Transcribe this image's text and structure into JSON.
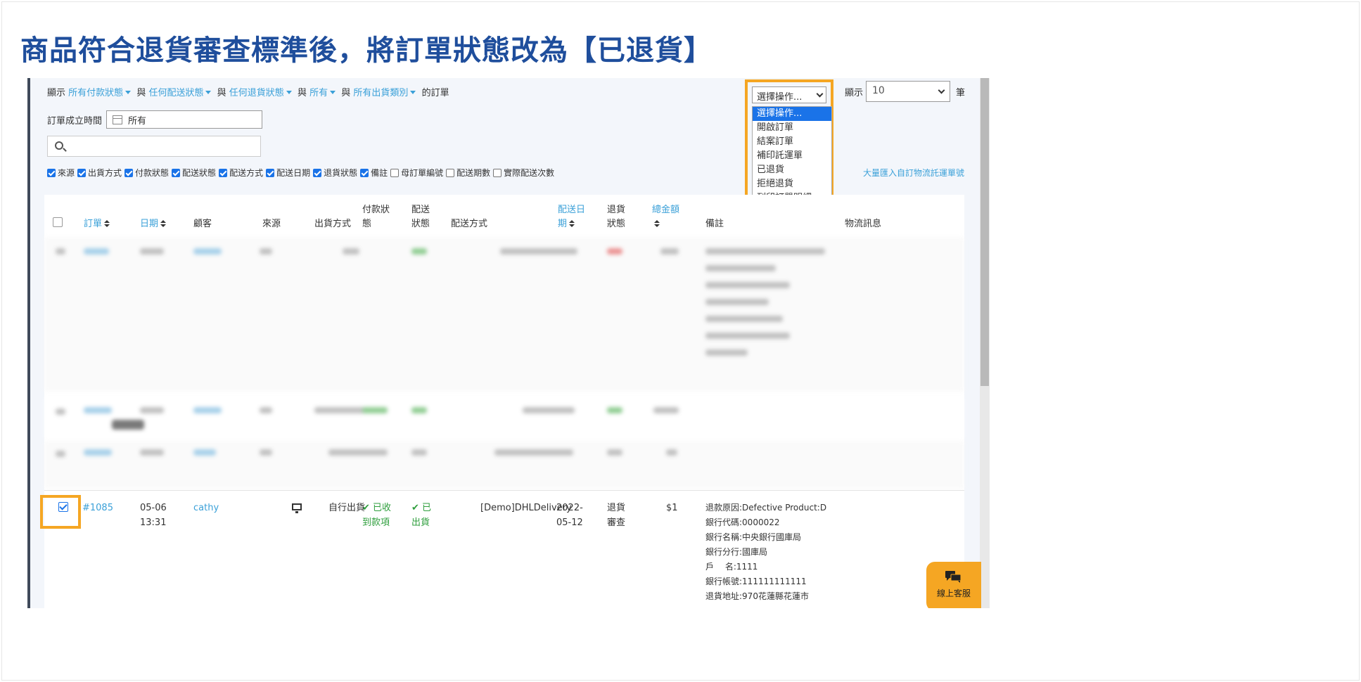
{
  "page_title": "商品符合退貨審查標準後，將訂單狀態改為【已退貨】",
  "filters": {
    "show_label": "顯示",
    "payment_status": "所有付款狀態",
    "and1": "與",
    "delivery_status": "任何配送狀態",
    "and2": "與",
    "return_status": "任何退貨狀態",
    "and3": "與",
    "all": "所有",
    "and4": "與",
    "ship_type": "所有出貨類別",
    "suffix": "的訂單",
    "date_label": "訂單成立時間",
    "date_value": "所有",
    "search_placeholder": ""
  },
  "column_toggles": [
    {
      "label": "來源",
      "checked": true
    },
    {
      "label": "出貨方式",
      "checked": true
    },
    {
      "label": "付款狀態",
      "checked": true
    },
    {
      "label": "配送狀態",
      "checked": true
    },
    {
      "label": "配送方式",
      "checked": true
    },
    {
      "label": "配送日期",
      "checked": true
    },
    {
      "label": "退貨狀態",
      "checked": true
    },
    {
      "label": "備註",
      "checked": true
    },
    {
      "label": "母訂單編號",
      "checked": false
    },
    {
      "label": "配送期數",
      "checked": false
    },
    {
      "label": "實際配送次數",
      "checked": false
    }
  ],
  "bulk_import_link": "大量匯入自訂物流託運單號",
  "actions": {
    "selected": "選擇操作...",
    "options": [
      "選擇操作...",
      "開啟訂單",
      "結案訂單",
      "補印託運單",
      "已退貨",
      "拒絕退貨",
      "列印訂單明細"
    ]
  },
  "page_size": {
    "label": "顯示",
    "value": "10",
    "unit": "筆"
  },
  "table": {
    "headers": {
      "order": "訂單",
      "date": "日期",
      "customer": "顧客",
      "source": "來源",
      "ship_method": "出貨方式",
      "payment_status_1": "付款狀",
      "payment_status_2": "態",
      "delivery_status_1": "配送",
      "delivery_status_2": "狀態",
      "delivery_method": "配送方式",
      "delivery_date_1": "配送日",
      "delivery_date_2": "期",
      "return_status_1": "退貨",
      "return_status_2": "狀態",
      "total_1": "總金額",
      "notes": "備註",
      "logistics": "物流訊息"
    },
    "row": {
      "order_no": "#1085",
      "date_1": "05-06",
      "date_2": "13:31",
      "customer": "cathy",
      "ship_method": "自行出貨",
      "payment_1": "✔ 已收",
      "payment_2": "到款項",
      "delivery_1": "✔ 已",
      "delivery_2": "出貨",
      "delivery_method": "[Demo]DHLDelivery",
      "delivery_date_1": "2022-",
      "delivery_date_2": "05-12",
      "return_1": "退貨",
      "return_2": "審查",
      "total": "$1",
      "notes": [
        "退款原因:Defective Product:D",
        "銀行代碼:0000022",
        "銀行名稱:中央銀行國庫局",
        "銀行分行:國庫局",
        "戶　 名:1111",
        "銀行帳號:111111111111",
        "退貨地址:970花蓮縣花蓮市"
      ]
    }
  },
  "chat_widget": {
    "label": "線上客服"
  }
}
